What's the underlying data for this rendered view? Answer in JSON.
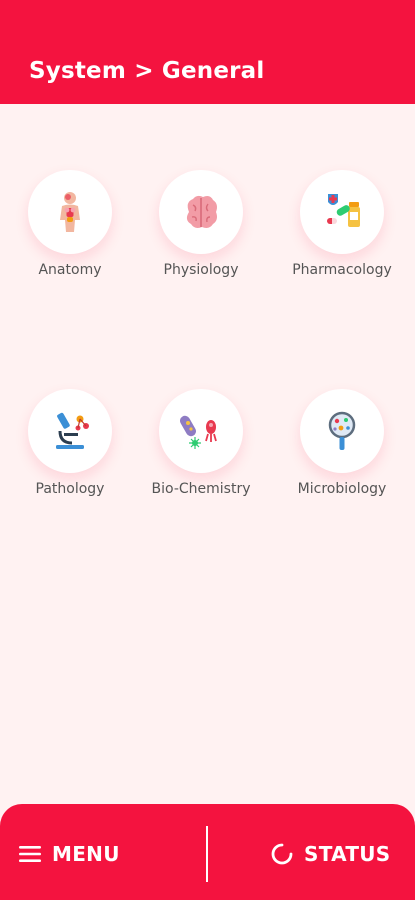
{
  "header": {
    "title": "System > General"
  },
  "subjects": [
    {
      "label": "Anatomy",
      "icon": "anatomy-body-icon"
    },
    {
      "label": "Physiology",
      "icon": "brain-icon"
    },
    {
      "label": "Pharmacology",
      "icon": "medicine-icon"
    },
    {
      "label": "Pathology",
      "icon": "microscope-icon"
    },
    {
      "label": "Bio-Chemistry",
      "icon": "bacteria-icon"
    },
    {
      "label": "Microbiology",
      "icon": "magnifier-cells-icon"
    }
  ],
  "bottom_bar": {
    "menu_label": "MENU",
    "status_label": "STATUS"
  },
  "colors": {
    "accent": "#f4133f",
    "background": "#fff2f2",
    "label_text": "#555555"
  }
}
